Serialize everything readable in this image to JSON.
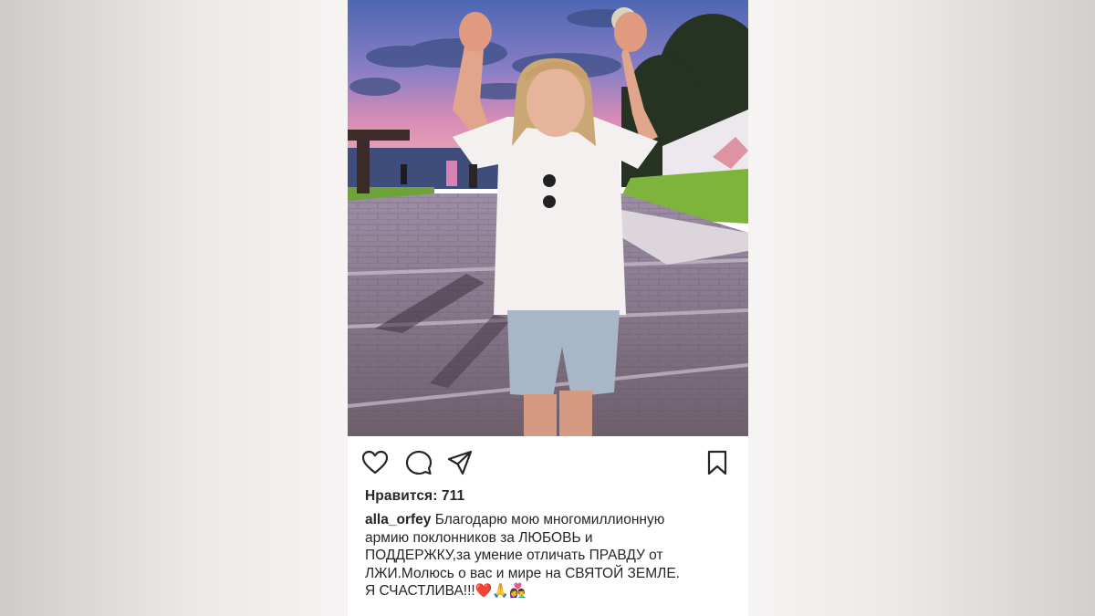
{
  "post": {
    "photo_alt": "",
    "likes_text": "Нравится: 711",
    "username": "alla_orfey",
    "caption_lines": [
      "Благодарю мою многомиллионную",
      "армию поклонников за ЛЮБОВЬ и",
      "ПОДДЕРЖКУ,за умение отличать ПРАВДУ от",
      "ЛЖИ.Молюсь о вас и мире на СВЯТОЙ ЗЕМЛЕ.",
      "Я СЧАСТЛИВА!!!"
    ],
    "caption_emoji": "❤️🙏👩‍❤️‍👨"
  },
  "icons": {
    "like": "heart-icon",
    "comment": "comment-icon",
    "share": "paper-plane-icon",
    "save": "bookmark-icon"
  },
  "colors": {
    "text": "#262626",
    "background_outer": "#f6f4f3",
    "card": "#ffffff"
  }
}
